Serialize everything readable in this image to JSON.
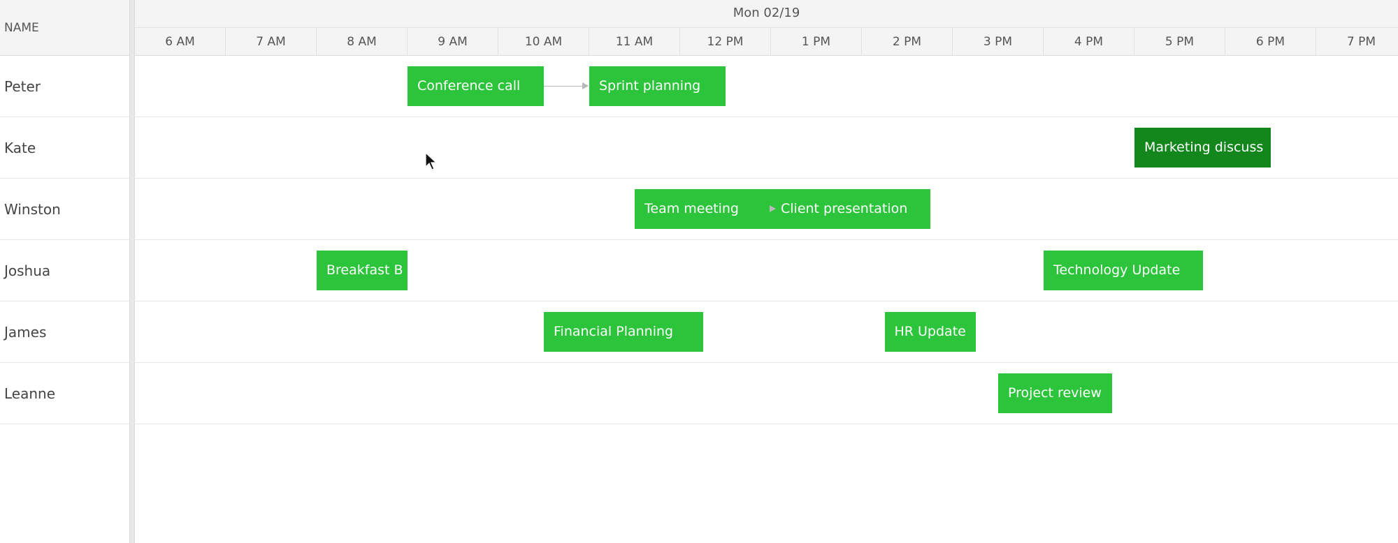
{
  "header": {
    "name_column_label": "NAME",
    "date_label": "Mon 02/19",
    "hours": [
      "6 AM",
      "7 AM",
      "8 AM",
      "9 AM",
      "10 AM",
      "11 AM",
      "12 PM",
      "1 PM",
      "2 PM",
      "3 PM",
      "4 PM",
      "5 PM",
      "6 PM",
      "7 PM"
    ]
  },
  "resources": [
    {
      "name": "Peter",
      "events": [
        {
          "label": "Conference call",
          "start": "9:00 AM",
          "end": "10:30 AM"
        },
        {
          "label": "Sprint planning",
          "start": "11:00 AM",
          "end": "12:30 PM"
        }
      ]
    },
    {
      "name": "Kate",
      "events": [
        {
          "label": "Marketing discuss",
          "start": "5:00 PM",
          "end": "6:30 PM",
          "selected": true
        }
      ]
    },
    {
      "name": "Winston",
      "events": [
        {
          "label": "Team meeting",
          "start": "11:30 AM",
          "end": "1:00 PM"
        },
        {
          "label": "Client presentation",
          "start": "1:00 PM",
          "end": "2:45 PM"
        }
      ]
    },
    {
      "name": "Joshua",
      "events": [
        {
          "label": "Breakfast B",
          "start": "8:00 AM",
          "end": "9:00 AM"
        },
        {
          "label": "Technology Update",
          "start": "4:00 PM",
          "end": "5:45 PM"
        }
      ]
    },
    {
      "name": "James",
      "events": [
        {
          "label": "Financial Planning",
          "start": "10:30 AM",
          "end": "12:15 PM"
        },
        {
          "label": "HR Update",
          "start": "2:15 PM",
          "end": "3:15 PM"
        }
      ]
    },
    {
      "name": "Leanne",
      "events": [
        {
          "label": "Project review",
          "start": "3:30 PM",
          "end": "4:45 PM"
        }
      ]
    }
  ],
  "dependencies": [
    {
      "resource": "Peter",
      "from": "Conference call",
      "to": "Sprint planning"
    },
    {
      "resource": "Winston",
      "from": "Team meeting",
      "to": "Client presentation"
    }
  ],
  "colors": {
    "event": "#2cc43a",
    "event_selected": "#13861c",
    "header_background": "#f4f4f4",
    "connector": "#b8b8b8"
  },
  "icons": {
    "cursor": "mouse-pointer-icon",
    "connector_arrow": "arrow-right-icon"
  }
}
